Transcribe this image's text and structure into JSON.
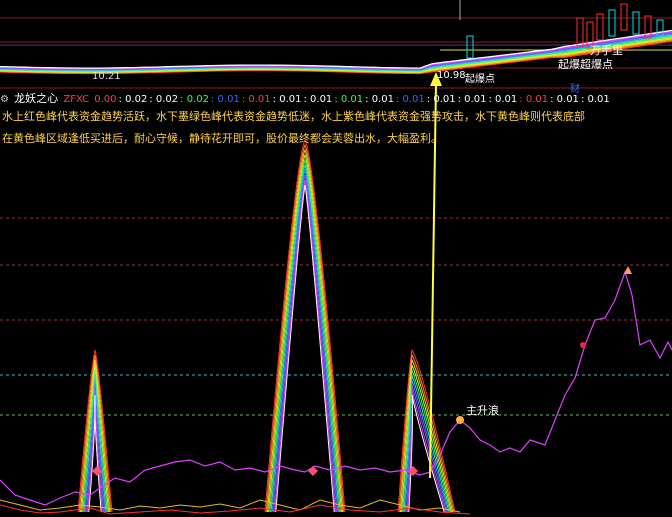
{
  "main_panel": {
    "price_labels": {
      "left": "10.21",
      "center": "10.98",
      "center_tag": "起爆点"
    },
    "right_labels": {
      "wan": "万手里",
      "qibao": "起爆超爆点"
    },
    "cai_marker": "财"
  },
  "indicator": {
    "title": "龙妖之心",
    "zfxc_label": "ZFXC",
    "zfxc_values": [
      "0.00",
      "0.02",
      "0.02",
      "0.02",
      "0.01",
      "0.01",
      "0.01",
      "0.01",
      "0.01",
      "0.01",
      "0.01",
      "0.01",
      "0.01",
      "0.01",
      "0.01",
      "0.01",
      "0.01"
    ],
    "description_line1": "水上红色峰代表资金趋势活跃，水下墨绿色峰代表资金趋势低迷，水上紫色峰代表资金强势攻击，水下黄色峰则代表底部",
    "description_line2": "在黄色峰区域逢低买进后，耐心守候，静待花开即可，股价最终都会芙蓉出水，大幅盈利。",
    "signal_label": "主升浪"
  },
  "colors": {
    "background": "#000000",
    "accent_yellow": "#ffff40",
    "purple_line": "#e040ff",
    "red": "#ff3030",
    "cyan_dash": "#33c0c0",
    "green_dash": "#60c060",
    "red_dash": "#a03030"
  }
}
